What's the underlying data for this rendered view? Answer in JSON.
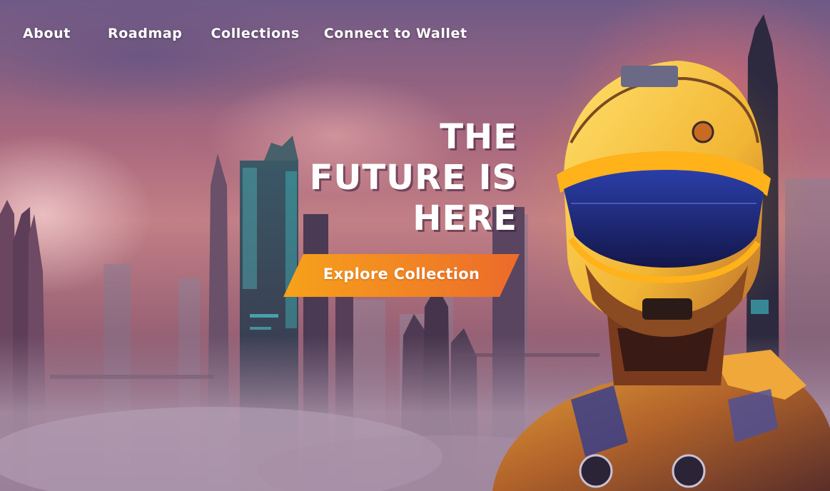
{
  "nav": {
    "items": [
      {
        "label": "About"
      },
      {
        "label": "Roadmap"
      },
      {
        "label": "Collections"
      },
      {
        "label": "Connect to Wallet"
      }
    ]
  },
  "hero": {
    "headline_lines": [
      "THE",
      "FUTURE IS",
      "HERE"
    ],
    "cta_label": "Explore Collection",
    "image_subject": "futuristic cyberpunk city skyline with armored helmeted robot figure"
  },
  "colors": {
    "cta_gradient_start": "#f7a21b",
    "cta_gradient_end": "#ec6a2b",
    "text": "#ffffff",
    "helmet_glow": "#ffb21a"
  }
}
